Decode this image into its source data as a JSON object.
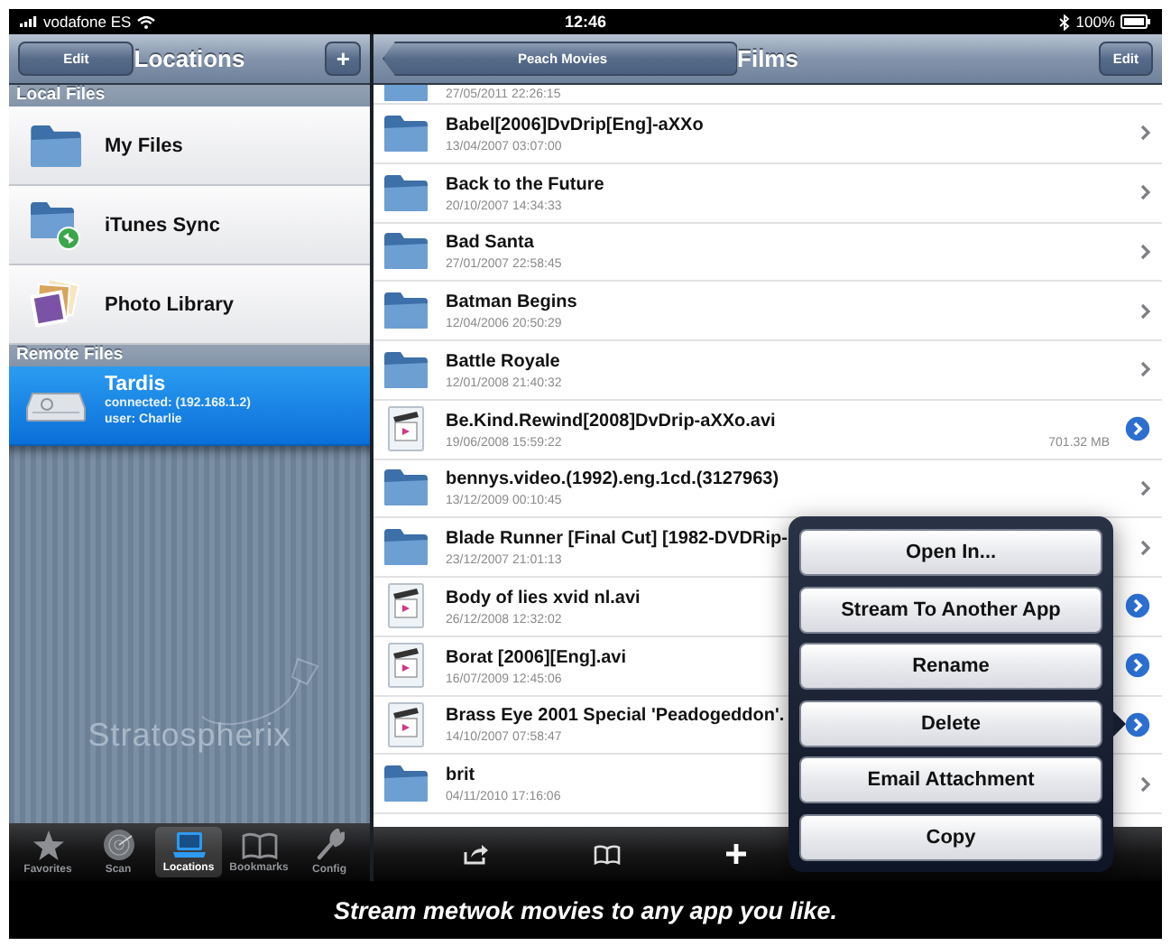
{
  "status_bar": {
    "carrier": "vodafone ES",
    "time": "12:46",
    "battery": "100%"
  },
  "locations": {
    "nav": {
      "left_button": "Edit",
      "title": "Locations",
      "right_button": "+"
    },
    "sections": [
      {
        "header": "Local Files",
        "items": [
          {
            "kind": "folder",
            "label": "My Files",
            "selected": false
          },
          {
            "kind": "sync",
            "label": "iTunes Sync",
            "selected": false
          },
          {
            "kind": "photos",
            "label": "Photo Library",
            "selected": false
          }
        ]
      },
      {
        "header": "Remote Files",
        "items": [
          {
            "kind": "server",
            "label": "Tardis",
            "details": [
              "connected: (192.168.1.2)",
              "user: Charlie"
            ],
            "selected": true
          }
        ]
      }
    ],
    "brand": "Stratospherix"
  },
  "tab_bar": [
    {
      "label": "Favorites",
      "selected": false
    },
    {
      "label": "Scan",
      "selected": false
    },
    {
      "label": "Locations",
      "selected": true
    },
    {
      "label": "Bookmarks",
      "selected": false
    },
    {
      "label": "Config",
      "selected": false
    }
  ],
  "films": {
    "nav": {
      "back_button": "Peach Movies",
      "title": "Films",
      "right_button": "Edit"
    },
    "rows": [
      {
        "kind": "folder",
        "date": "27/05/2011 22:26:15"
      },
      {
        "kind": "folder",
        "name": "Babel[2006]DvDrip[Eng]-aXXo",
        "date": "13/04/2007 03:07:00"
      },
      {
        "kind": "folder",
        "name": "Back to the Future",
        "date": "20/10/2007 14:34:33"
      },
      {
        "kind": "folder",
        "name": "Bad Santa",
        "date": "27/01/2007 22:58:45"
      },
      {
        "kind": "folder",
        "name": "Batman Begins",
        "date": "12/04/2006 20:50:29"
      },
      {
        "kind": "folder",
        "name": "Battle Royale",
        "date": "12/01/2008 21:40:32"
      },
      {
        "kind": "video",
        "name": "Be.Kind.Rewind[2008]DvDrip-aXXo.avi",
        "date": "19/06/2008 15:59:22",
        "size": "701.32 MB"
      },
      {
        "kind": "folder",
        "name": "bennys.video.(1992).eng.1cd.(3127963)",
        "date": "13/12/2009 00:10:45"
      },
      {
        "kind": "folder",
        "name": "Blade Runner [Final Cut] [1982-DVDRip-",
        "date": "23/12/2007 21:01:13"
      },
      {
        "kind": "video",
        "name": "Body of lies xvid nl.avi",
        "date": "26/12/2008 12:32:02"
      },
      {
        "kind": "video",
        "name": "Borat [2006][Eng].avi",
        "date": "16/07/2009 12:45:06"
      },
      {
        "kind": "video",
        "name": "Brass Eye 2001 Special 'Peadogeddon'.",
        "date": "14/10/2007 07:58:47"
      },
      {
        "kind": "folder",
        "name": "brit",
        "date": "04/11/2010 17:16:06"
      }
    ]
  },
  "popover": {
    "items": [
      "Open In...",
      "Stream To Another App",
      "Rename",
      "Delete",
      "Email Attachment",
      "Copy"
    ]
  },
  "caption": "Stream metwok movies to any app you like."
}
